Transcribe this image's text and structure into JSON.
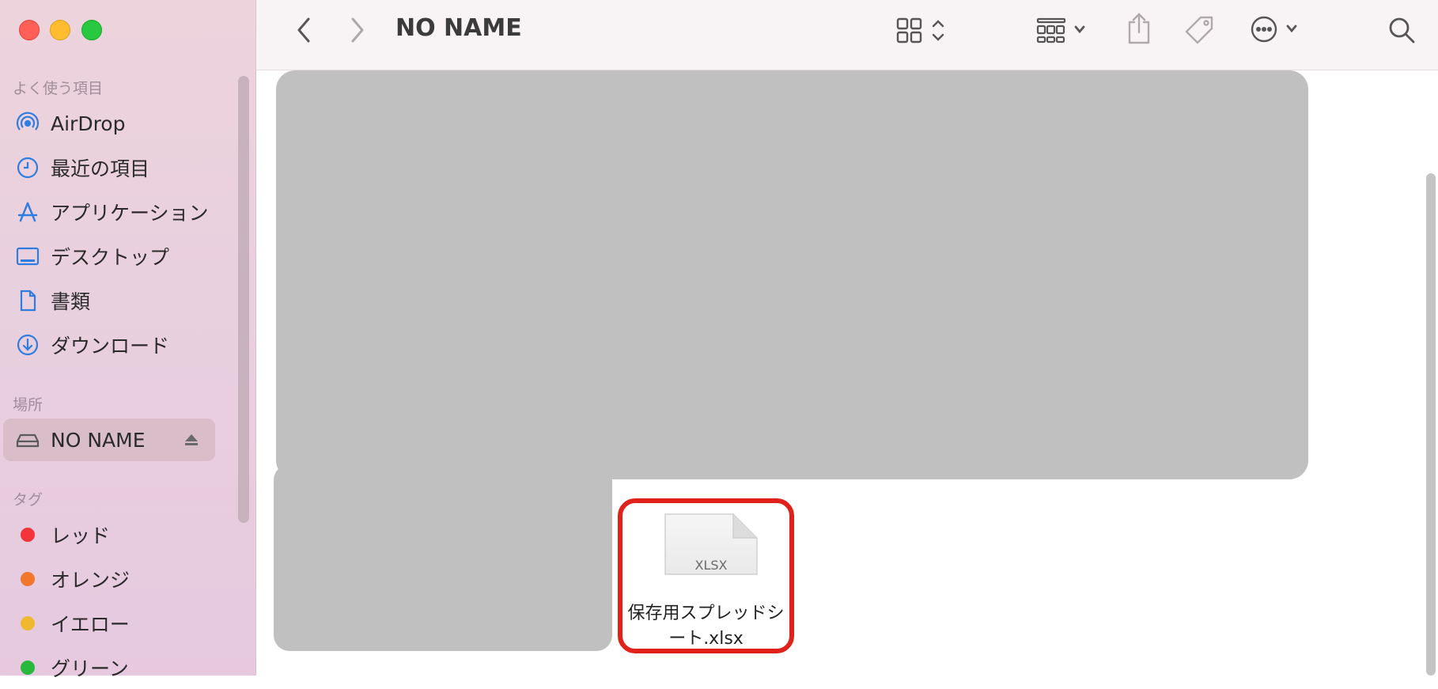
{
  "window": {
    "title": "NO NAME"
  },
  "sidebar": {
    "favorites_header": "よく使う項目",
    "favorites": [
      {
        "label": "AirDrop",
        "icon": "airdrop-icon"
      },
      {
        "label": "最近の項目",
        "icon": "clock-icon"
      },
      {
        "label": "アプリケーション",
        "icon": "applications-icon"
      },
      {
        "label": "デスクトップ",
        "icon": "desktop-icon"
      },
      {
        "label": "書類",
        "icon": "document-icon"
      },
      {
        "label": "ダウンロード",
        "icon": "download-icon"
      }
    ],
    "locations_header": "場所",
    "locations": [
      {
        "label": "NO NAME",
        "icon": "drive-icon",
        "selected": true
      }
    ],
    "tags_header": "タグ",
    "tags": [
      {
        "label": "レッド",
        "color": "#f5333a"
      },
      {
        "label": "オレンジ",
        "color": "#f0772b"
      },
      {
        "label": "イエロー",
        "color": "#f0b82f"
      },
      {
        "label": "グリーン",
        "color": "#28b83e"
      }
    ]
  },
  "toolbar": {
    "icons": [
      "back-icon",
      "forward-icon",
      "icon-view-icon",
      "group-icon",
      "share-icon",
      "tag-icon",
      "more-icon",
      "search-icon"
    ]
  },
  "files": [
    {
      "name": "保存用スプレッドシート.xlsx",
      "name_line1": "保存用スプレッドシ",
      "name_line2": "ート.xlsx",
      "type_label": "XLSX",
      "highlighted": true
    }
  ],
  "colors": {
    "accent": "#2f7de1",
    "highlight": "#e1221a",
    "redaction": "#c0c0c0"
  }
}
